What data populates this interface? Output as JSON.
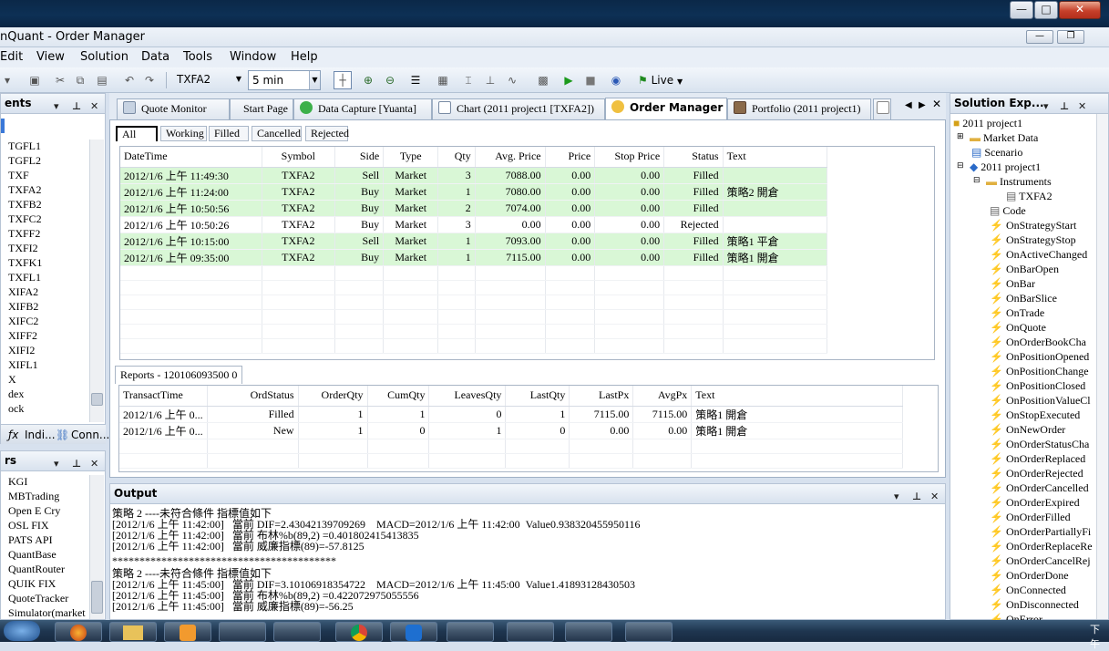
{
  "window": {
    "title": "nQuant - Order Manager",
    "minimize": "—",
    "maximize": "□",
    "close": "✕",
    "mdi_min": "—",
    "mdi_restore": "❐"
  },
  "menu": [
    "Edit",
    "View",
    "Solution",
    "Data",
    "Tools",
    "Window",
    "Help"
  ],
  "toolbar": {
    "instrument": "TXFA2",
    "bar_size": "5 min",
    "live_label": "Live"
  },
  "left_top_panel": {
    "title": "ents",
    "items": [
      "TGFL1",
      "TGFL2",
      "TXF",
      "TXFA2",
      "TXFB2",
      "TXFC2",
      "TXFF2",
      "TXFI2",
      "TXFK1",
      "TXFL1",
      "XIFA2",
      "XIFB2",
      "XIFC2",
      "XIFF2",
      "XIFI2",
      "XIFL1",
      "X",
      "dex",
      "ock"
    ],
    "tab_indicators": "Indi...",
    "tab_connections": "Conn..."
  },
  "left_bottom_panel": {
    "title": "rs",
    "items": [
      "KGI",
      "MBTrading",
      "Open E Cry",
      "OSL FIX",
      "PATS API",
      "QuantBase",
      "QuantRouter",
      "QUIK FIX",
      "QuoteTracker",
      "Simulator(market d"
    ]
  },
  "doc_tabs": [
    "Quote Monitor",
    "Start Page",
    "Data Capture [Yuanta]",
    "Chart (2011 project1 [TXFA2])",
    "Order Manager",
    "Portfolio (2011 project1)"
  ],
  "filter_tabs": [
    "All",
    "Working",
    "Filled",
    "Cancelled",
    "Rejected"
  ],
  "orders": {
    "columns": [
      "DateTime",
      "Symbol",
      "Side",
      "Type",
      "Qty",
      "Avg. Price",
      "Price",
      "Stop Price",
      "Status",
      "Text"
    ],
    "rows": [
      {
        "datetime": "2012/1/6 上午 11:49:30",
        "symbol": "TXFA2",
        "side": "Sell",
        "type": "Market",
        "qty": "3",
        "avg": "7088.00",
        "price": "0.00",
        "stop": "0.00",
        "status": "Filled",
        "text": ""
      },
      {
        "datetime": "2012/1/6 上午 11:24:00",
        "symbol": "TXFA2",
        "side": "Buy",
        "type": "Market",
        "qty": "1",
        "avg": "7080.00",
        "price": "0.00",
        "stop": "0.00",
        "status": "Filled",
        "text": "策略2 開倉"
      },
      {
        "datetime": "2012/1/6 上午 10:50:56",
        "symbol": "TXFA2",
        "side": "Buy",
        "type": "Market",
        "qty": "2",
        "avg": "7074.00",
        "price": "0.00",
        "stop": "0.00",
        "status": "Filled",
        "text": ""
      },
      {
        "datetime": "2012/1/6 上午 10:50:26",
        "symbol": "TXFA2",
        "side": "Buy",
        "type": "Market",
        "qty": "3",
        "avg": "0.00",
        "price": "0.00",
        "stop": "0.00",
        "status": "Rejected",
        "text": ""
      },
      {
        "datetime": "2012/1/6 上午 10:15:00",
        "symbol": "TXFA2",
        "side": "Sell",
        "type": "Market",
        "qty": "1",
        "avg": "7093.00",
        "price": "0.00",
        "stop": "0.00",
        "status": "Filled",
        "text": "策略1 平倉"
      },
      {
        "datetime": "2012/1/6 上午 09:35:00",
        "symbol": "TXFA2",
        "side": "Buy",
        "type": "Market",
        "qty": "1",
        "avg": "7115.00",
        "price": "0.00",
        "stop": "0.00",
        "status": "Filled",
        "text": "策略1 開倉"
      }
    ]
  },
  "reports": {
    "tab": "Reports - 120106093500 0",
    "columns": [
      "TransactTime",
      "OrdStatus",
      "OrderQty",
      "CumQty",
      "LeavesQty",
      "LastQty",
      "LastPx",
      "AvgPx",
      "Text"
    ],
    "rows": [
      {
        "time": "2012/1/6 上午 0...",
        "status": "Filled",
        "orderqty": "1",
        "cumqty": "1",
        "leaves": "0",
        "lastqty": "1",
        "lastpx": "7115.00",
        "avgpx": "7115.00",
        "text": "策略1 開倉"
      },
      {
        "time": "2012/1/6 上午 0...",
        "status": "New",
        "orderqty": "1",
        "cumqty": "0",
        "leaves": "1",
        "lastqty": "0",
        "lastpx": "0.00",
        "avgpx": "0.00",
        "text": "策略1 開倉"
      }
    ]
  },
  "output": {
    "title": "Output",
    "lines": [
      "策略 2 ----未符合條件 指標值如下",
      "[2012/1/6 上午 11:42:00]   當前 DIF=2.43042139709269    MACD=2012/1/6 上午 11:42:00  Value0.938320455950116",
      "[2012/1/6 上午 11:42:00]   當前 布林%b(89,2) =0.401802415413835",
      "[2012/1/6 上午 11:42:00]   當前 威廉指標(89)=-57.8125",
      "*****************************************",
      "策略 2 ----未符合條件 指標值如下",
      "[2012/1/6 上午 11:45:00]   當前 DIF=3.10106918354722    MACD=2012/1/6 上午 11:45:00  Value1.41893128430503",
      "[2012/1/6 上午 11:45:00]   當前 布林%b(89,2) =0.422072975055556",
      "[2012/1/6 上午 11:45:00]   當前 威廉指標(89)=-56.25"
    ]
  },
  "solution": {
    "title": "Solution Exp...",
    "project": "2011 project1",
    "market_data": "Market Data",
    "scenario": "Scenario",
    "project2": "2011 project1",
    "instruments": "Instruments",
    "instrument": "TXFA2",
    "code": "Code",
    "events": [
      "OnStrategyStart",
      "OnStrategyStop",
      "OnActiveChanged",
      "OnBarOpen",
      "OnBar",
      "OnBarSlice",
      "OnTrade",
      "OnQuote",
      "OnOrderBookCha",
      "OnPositionOpened",
      "OnPositionChange",
      "OnPositionClosed",
      "OnPositionValueCl",
      "OnStopExecuted",
      "OnNewOrder",
      "OnOrderStatusCha",
      "OnOrderReplaced",
      "OnOrderRejected",
      "OnOrderCancelled",
      "OnOrderExpired",
      "OnOrderFilled",
      "OnOrderPartiallyFi",
      "OnOrderReplaceRe",
      "OnOrderCancelRej",
      "OnOrderDone",
      "OnConnected",
      "OnDisconnected",
      "OnError"
    ]
  },
  "taskbar": {
    "clock": "下午"
  }
}
